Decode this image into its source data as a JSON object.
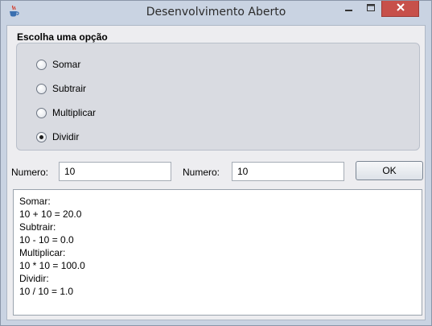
{
  "window": {
    "title": "Desenvolvimento Aberto",
    "icon": "java-cup-icon",
    "controls": [
      "minimize-icon",
      "maximize-icon",
      "close-icon"
    ]
  },
  "options_group": {
    "label": "Escolha uma opção",
    "options": [
      {
        "label": "Somar",
        "selected": false
      },
      {
        "label": "Subtrair",
        "selected": false
      },
      {
        "label": "Multiplicar",
        "selected": false
      },
      {
        "label": "Dividir",
        "selected": true
      }
    ]
  },
  "inputs": {
    "first_label": "Numero:",
    "first_value": "10",
    "second_label": "Numero:",
    "second_value": "10"
  },
  "ok_button": {
    "label": "OK"
  },
  "output": {
    "lines": [
      "Somar:",
      "10 + 10 = 20.0",
      "Subtrair:",
      "10 - 10 = 0.0",
      "Multiplicar:",
      "10 * 10 = 100.0",
      "Dividir:",
      "10 / 10 = 1.0"
    ]
  },
  "colors": {
    "frame": "#c9d3e2",
    "close_button": "#c7504a",
    "client_background": "#ededf0",
    "group_background": "#d9dbe1"
  }
}
